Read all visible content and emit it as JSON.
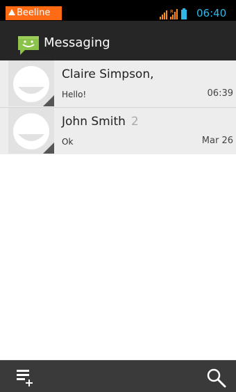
{
  "status_bar": {
    "carrier": "Beeline",
    "time": "06:40",
    "carrier_color": "#ff6a13",
    "time_color": "#33b5e5"
  },
  "action_bar": {
    "title": "Messaging",
    "icon": "messaging-app-icon"
  },
  "conversations": [
    {
      "name": "Claire Simpson,",
      "count": "",
      "snippet": "Hello!",
      "time": "06:39"
    },
    {
      "name": "John Smith",
      "count": "2",
      "snippet": "Ok",
      "time": "Mar 26"
    }
  ],
  "bottom_bar": {
    "compose_icon": "new-message-icon",
    "search_icon": "search-icon"
  }
}
